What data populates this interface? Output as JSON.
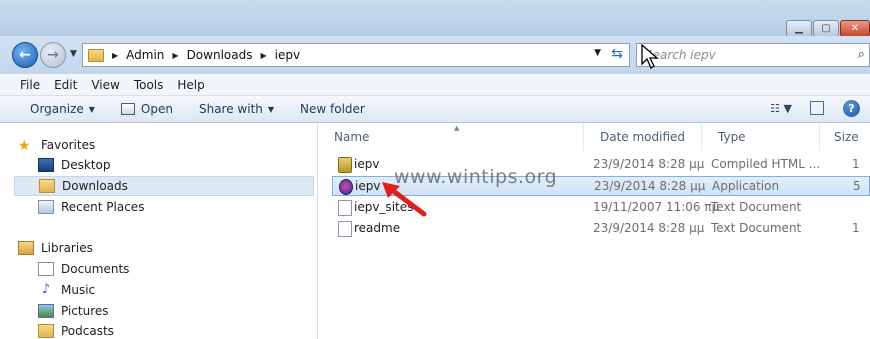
{
  "window": {
    "controls": {
      "minimize_icon": "minimize-icon",
      "maximize_icon": "maximize-icon",
      "close_icon": "close-icon"
    }
  },
  "address_bar": {
    "crumbs": [
      "Admin",
      "Downloads",
      "iepv"
    ],
    "search_placeholder": "Search iepv"
  },
  "menu": [
    "File",
    "Edit",
    "View",
    "Tools",
    "Help"
  ],
  "commands": {
    "organize": "Organize",
    "open": "Open",
    "share_with": "Share with",
    "new_folder": "New folder"
  },
  "nav_pane": {
    "favorites": "Favorites",
    "desktop": "Desktop",
    "downloads": "Downloads",
    "recent_places": "Recent Places",
    "libraries": "Libraries",
    "documents": "Documents",
    "music": "Music",
    "pictures": "Pictures",
    "podcasts": "Podcasts"
  },
  "columns": {
    "name": "Name",
    "date_modified": "Date modified",
    "type": "Type",
    "size": "Size"
  },
  "files": [
    {
      "name": "iepv",
      "date": "23/9/2014 8:28 μμ",
      "type": "Compiled HTML ...",
      "size": "1",
      "icon": "chm-icon"
    },
    {
      "name": "iepv",
      "date": "23/9/2014 8:28 μμ",
      "type": "Application",
      "size": "5",
      "icon": "application-icon"
    },
    {
      "name": "iepv_sites",
      "date": "19/11/2007 11:06 πμ",
      "type": "Text Document",
      "size": "",
      "icon": "text-file-icon"
    },
    {
      "name": "readme",
      "date": "23/9/2014 8:28 μμ",
      "type": "Text Document",
      "size": "1",
      "icon": "text-file-icon"
    }
  ],
  "watermark": "www.wintips.org",
  "colors": {
    "selection": "#cfe2f7",
    "arrow": "#e02020",
    "titlebar": "#c4d8ee"
  }
}
